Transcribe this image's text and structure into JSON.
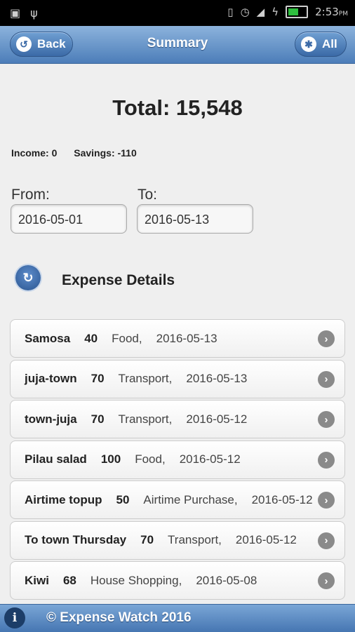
{
  "status_bar": {
    "time": "2:53",
    "ampm": "PM"
  },
  "header": {
    "title": "Summary",
    "back_label": "Back",
    "all_label": "All"
  },
  "summary": {
    "total": "Total: 15,548",
    "income": "Income: 0",
    "savings": "Savings: -110"
  },
  "dates": {
    "from_label": "From:",
    "from_value": "2016-05-01",
    "to_label": "To:",
    "to_value": "2016-05-13"
  },
  "section": {
    "title": "Expense Details"
  },
  "expenses": [
    {
      "name": "Samosa",
      "amount": "40",
      "category": "Food,",
      "date": "2016-05-13"
    },
    {
      "name": "juja-town",
      "amount": "70",
      "category": "Transport,",
      "date": "2016-05-13"
    },
    {
      "name": "town-juja",
      "amount": "70",
      "category": "Transport,",
      "date": "2016-05-12"
    },
    {
      "name": "Pilau salad",
      "amount": "100",
      "category": "Food,",
      "date": "2016-05-12"
    },
    {
      "name": "Airtime topup",
      "amount": "50",
      "category": "Airtime Purchase,",
      "date": "2016-05-12"
    },
    {
      "name": "To town Thursday",
      "amount": "70",
      "category": "Transport,",
      "date": "2016-05-12"
    },
    {
      "name": "Kiwi",
      "amount": "68",
      "category": "House Shopping,",
      "date": "2016-05-08"
    }
  ],
  "footer": {
    "text": "© Expense Watch 2016"
  },
  "colors": {
    "header_blue": "#4c7db9",
    "accent": "#2a5590"
  },
  "icons": [
    "back-arrow-icon",
    "gear-icon",
    "refresh-icon",
    "chevron-right-icon",
    "info-icon"
  ]
}
